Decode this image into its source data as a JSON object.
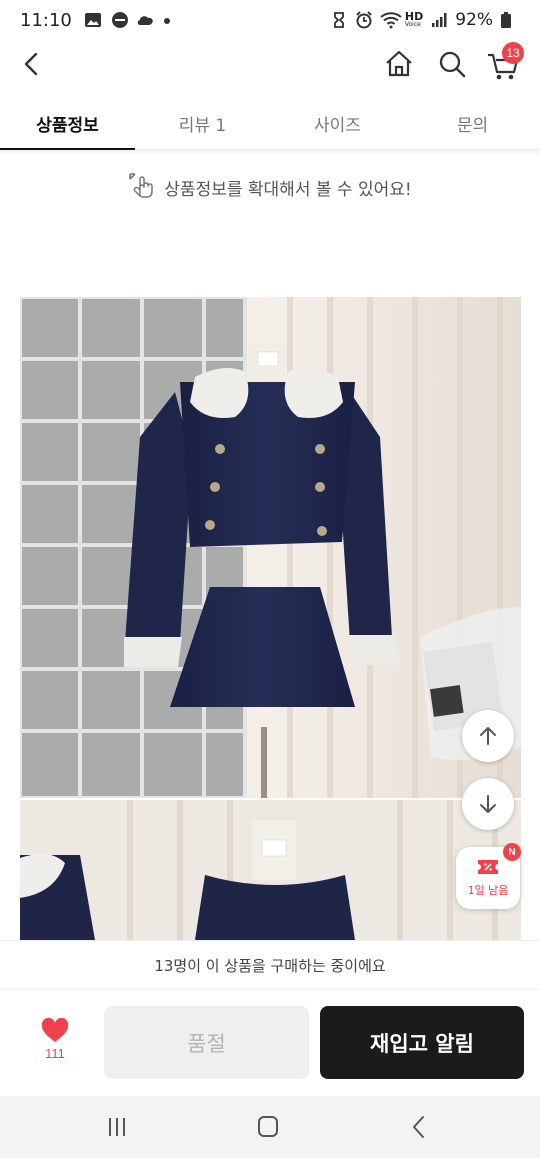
{
  "status_bar": {
    "time": "11:10",
    "hd_label": "HD",
    "voice_label": "Voice",
    "battery": "92%"
  },
  "nav": {
    "cart_count": "13"
  },
  "tabs": [
    {
      "label": "상품정보",
      "active": true
    },
    {
      "label": "리뷰 1",
      "active": false
    },
    {
      "label": "사이즈",
      "active": false
    },
    {
      "label": "문의",
      "active": false
    }
  ],
  "zoom_hint": "상품정보를 확대해서 볼 수 있어요!",
  "coupon": {
    "label": "1일 남음",
    "new_badge": "N"
  },
  "buy_notice": "13명이 이 상품을 구매하는 중이에요",
  "actions": {
    "like_count": "111",
    "soldout_label": "품절",
    "restock_label": "재입고 알림"
  },
  "colors": {
    "accent": "#f0414c",
    "dark_button": "#1b1b1b",
    "disabled_button": "#efefef",
    "navy_garment": "#1e2547"
  }
}
